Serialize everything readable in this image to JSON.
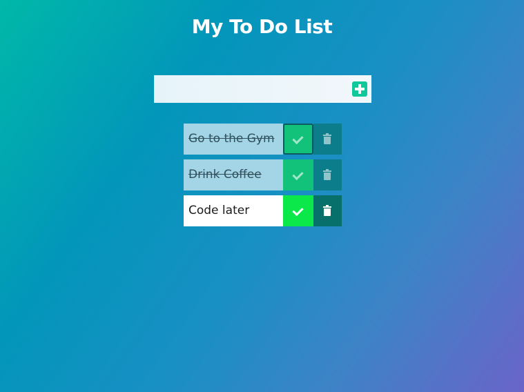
{
  "page": {
    "title": "My To Do List"
  },
  "add_bar": {
    "input_value": "",
    "placeholder": "",
    "add_icon": "plus-square-icon",
    "accent_color": "#11c89a"
  },
  "todos": [
    {
      "text": "Go to the Gym",
      "completed": true,
      "check_icon": "check-icon",
      "delete_icon": "trash-icon"
    },
    {
      "text": "Drink Coffee",
      "completed": true,
      "check_icon": "check-icon",
      "delete_icon": "trash-icon"
    },
    {
      "text": "Code later",
      "completed": false,
      "check_icon": "check-icon",
      "delete_icon": "trash-icon"
    }
  ],
  "colors": {
    "completed_item_bg": "#a3d5e6",
    "active_item_bg": "#ffffff",
    "check_completed": "#12c17a",
    "check_active": "#0ae84a",
    "trash_completed": "#0c7d8a",
    "trash_active": "#07706a"
  }
}
